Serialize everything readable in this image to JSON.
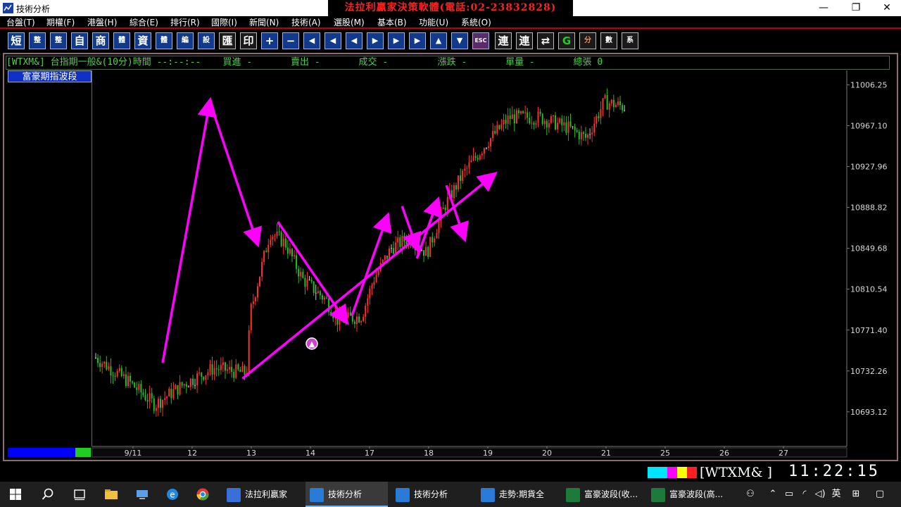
{
  "window": {
    "title": "技術分析",
    "banner": "法拉利贏家決策軟體(電話:02-23832828)",
    "controls": {
      "minimize": "—",
      "restore": "❐",
      "close": "✕"
    }
  },
  "menu": [
    "台盤(T)",
    "期權(F)",
    "港盤(H)",
    "綜合(E)",
    "排行(R)",
    "國際(I)",
    "新聞(N)",
    "技術(A)",
    "選股(M)",
    "基本(B)",
    "功能(U)",
    "系統(O)"
  ],
  "toolbar": [
    "短",
    "整",
    "整",
    "自",
    "商",
    "體",
    "資",
    "體",
    "編",
    "設",
    "匯",
    "印",
    "+",
    "−",
    "◀",
    "◀",
    "◀",
    "▶",
    "▶",
    "▶",
    "▲",
    "▼",
    "ESC",
    "連",
    "連",
    "⇄",
    "G",
    "分",
    "數",
    "系"
  ],
  "infobar": {
    "symbol": "[WTXM&]",
    "name": "台指期一般&(10分)",
    "time_label": "時間",
    "time_value": "--:--:--",
    "buy_label": "買進",
    "buy_value": "-",
    "sell_label": "賣出",
    "sell_value": "-",
    "deal_label": "成交",
    "deal_value": "-",
    "change_label": "漲跌",
    "change_value": "-",
    "vol_label": "單量",
    "vol_value": "-",
    "total_label": "總張",
    "total_value": "0"
  },
  "indicator_tab": "富豪期指波段",
  "chart_data": {
    "type": "candlestick",
    "y_ticks": [
      "11006.25",
      "10967.10",
      "10927.96",
      "10888.82",
      "10849.68",
      "10810.54",
      "10771.40",
      "10732.26",
      "10693.12"
    ],
    "ylim": [
      10660,
      11020
    ],
    "x_ticks": [
      "9/11",
      "12",
      "13",
      "14",
      "17",
      "18",
      "19",
      "20",
      "21",
      "25",
      "26",
      "27"
    ],
    "colors": {
      "up": "#ff3030",
      "down": "#22c022",
      "doji": "#c8c8c8",
      "arrow": "#ff00ff",
      "axis": "#7a7a7a"
    },
    "arrows": [
      {
        "from": [
          1.0,
          10740
        ],
        "to": [
          1.8,
          10990
        ]
      },
      {
        "from": [
          1.8,
          10990
        ],
        "to": [
          2.6,
          10855
        ]
      },
      {
        "from": [
          2.35,
          10725
        ],
        "to": [
          6.6,
          10920
        ]
      },
      {
        "from": [
          2.95,
          10875
        ],
        "to": [
          4.1,
          10780
        ]
      },
      {
        "from": [
          4.2,
          10785
        ],
        "to": [
          4.8,
          10880
        ]
      },
      {
        "from": [
          5.05,
          10890
        ],
        "to": [
          5.3,
          10850
        ]
      },
      {
        "from": [
          5.3,
          10840
        ],
        "to": [
          5.65,
          10895
        ]
      },
      {
        "from": [
          5.8,
          10910
        ],
        "to": [
          6.1,
          10860
        ]
      }
    ]
  },
  "status": {
    "symbol": "[WTXM&  ]",
    "time": "11:22:15",
    "colors": [
      "#00e5ff",
      "#ff00ff",
      "#ffff00",
      "#ff2020"
    ]
  },
  "taskbar": {
    "apps": [
      {
        "label": "法拉利贏家",
        "color": "#3a6fd8"
      },
      {
        "label": "技術分析",
        "color": "#2a7ad8",
        "active": true
      },
      {
        "label": "技術分析",
        "color": "#2a7ad8"
      },
      {
        "label": "走勢:期貨全",
        "color": "#2a7ad8"
      },
      {
        "label": "富豪波段(收...",
        "color": "#1d7a3a"
      },
      {
        "label": "富豪波段(高...",
        "color": "#1d7a3a"
      }
    ],
    "ime": "英"
  }
}
